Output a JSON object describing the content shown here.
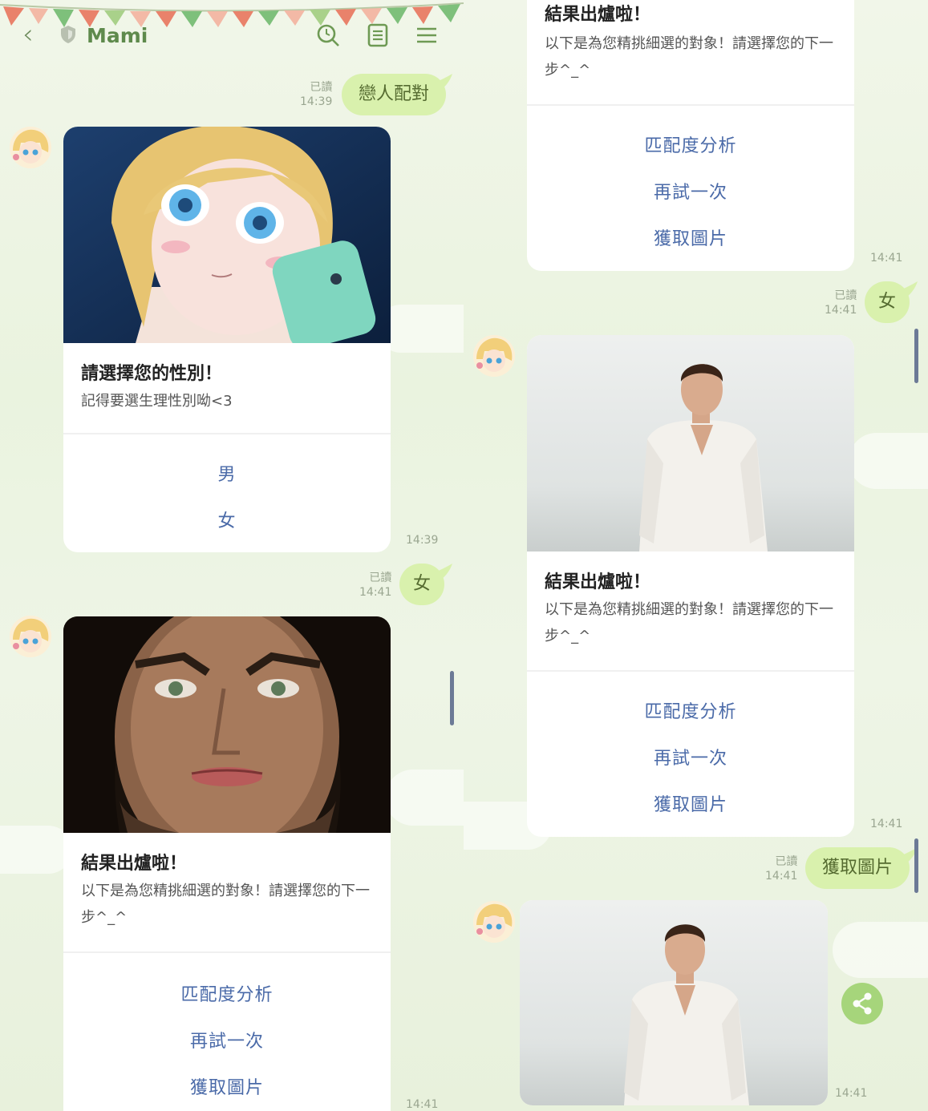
{
  "header": {
    "title": "Mami",
    "icons": [
      "back-icon",
      "shield-icon",
      "search-icon",
      "notes-icon",
      "menu-icon"
    ]
  },
  "left": {
    "user_msg_1": {
      "text": "戀人配對",
      "read": "已讀",
      "time": "14:39"
    },
    "gender_card": {
      "title": "請選擇您的性別！",
      "subtitle": "記得要選生理性別呦<3",
      "options": [
        "男",
        "女"
      ],
      "time": "14:39"
    },
    "user_msg_2": {
      "text": "女",
      "read": "已讀",
      "time": "14:41"
    },
    "result_card": {
      "title": "結果出爐啦！",
      "subtitle": "以下是為您精挑細選的對象！請選擇您的下一步^_^",
      "actions": [
        "匹配度分析",
        "再試一次",
        "獲取圖片"
      ],
      "time": "14:41"
    }
  },
  "right": {
    "result_card_top": {
      "title": "結果出爐啦！",
      "subtitle": "以下是為您精挑細選的對象！請選擇您的下一步^_^",
      "actions": [
        "匹配度分析",
        "再試一次",
        "獲取圖片"
      ],
      "time": "14:41"
    },
    "user_msg_3": {
      "text": "女",
      "read": "已讀",
      "time": "14:41"
    },
    "result_card_2": {
      "title": "結果出爐啦！",
      "subtitle": "以下是為您精挑細選的對象！請選擇您的下一步^_^",
      "actions": [
        "匹配度分析",
        "再試一次",
        "獲取圖片"
      ],
      "time": "14:41"
    },
    "user_msg_4": {
      "text": "獲取圖片",
      "read": "已讀",
      "time": "14:41"
    },
    "image_msg": {
      "time": "14:41"
    }
  },
  "colors": {
    "bubble": "#d9f1ad",
    "action_link": "#4a6aa8",
    "title_green": "#5e8a4c"
  }
}
